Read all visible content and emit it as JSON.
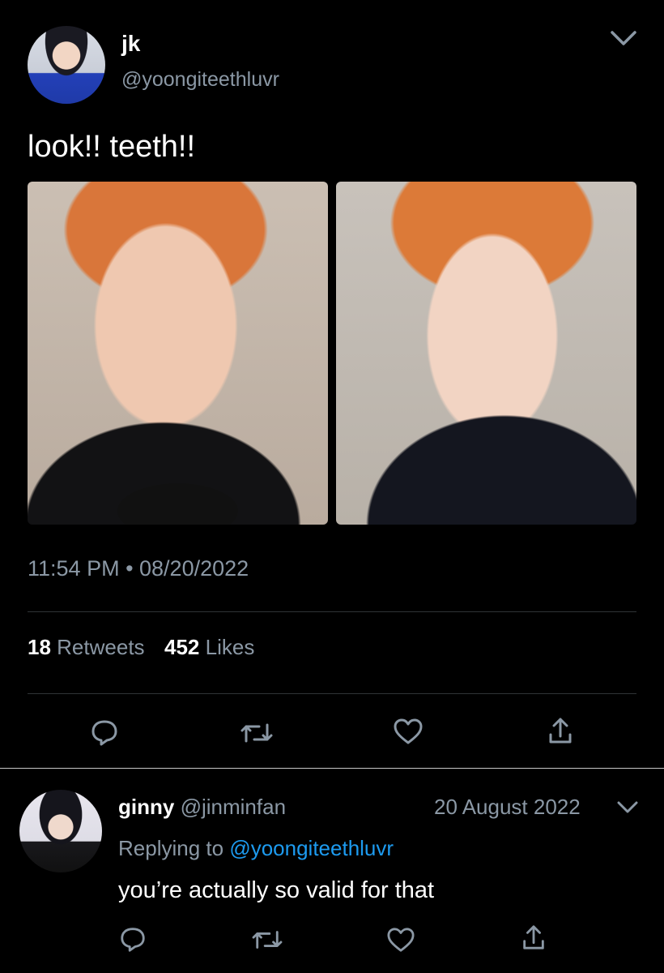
{
  "tweet": {
    "display_name": "jk",
    "handle": "@yoongiteethluvr",
    "text": "look!! teeth!!",
    "timestamp": "11:54 PM • 08/20/2022",
    "stats": {
      "retweets_count": "18",
      "retweets_label": "Retweets",
      "likes_count": "452",
      "likes_label": "Likes"
    }
  },
  "reply": {
    "display_name": "ginny",
    "handle": "@jinminfan",
    "date": "20 August 2022",
    "replying_prefix": "Replying to",
    "replying_handle": "@yoongiteethluvr",
    "text": "you’re actually so valid for that"
  },
  "colors": {
    "background": "#000000",
    "text": "#ffffff",
    "muted": "#8b98a5",
    "link": "#1d9bf0",
    "divider": "#2f3336"
  },
  "icons": [
    "chevron-down-icon",
    "reply-icon",
    "retweet-icon",
    "like-icon",
    "share-icon"
  ]
}
